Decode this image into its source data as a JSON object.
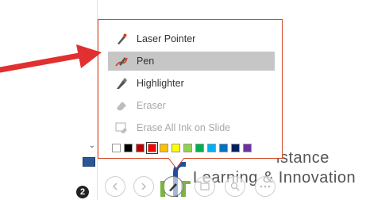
{
  "menu": {
    "items": [
      {
        "label": "Laser Pointer",
        "icon": "laser-pointer-icon",
        "enabled": true,
        "selected": false
      },
      {
        "label": "Pen",
        "icon": "pen-icon",
        "enabled": true,
        "selected": true
      },
      {
        "label": "Highlighter",
        "icon": "highlighter-icon",
        "enabled": true,
        "selected": false
      },
      {
        "label": "Eraser",
        "icon": "eraser-icon",
        "enabled": false,
        "selected": false
      },
      {
        "label": "Erase All Ink on Slide",
        "icon": "erase-all-icon",
        "enabled": false,
        "selected": false
      }
    ],
    "colors": [
      "#ffffff",
      "#000000",
      "#c00000",
      "#ff0000",
      "#ffc000",
      "#ffff00",
      "#92d050",
      "#00b050",
      "#00b0f0",
      "#0070c0",
      "#002060",
      "#7030a0"
    ],
    "selected_color": "#ff0000",
    "accent_border": "#d24726"
  },
  "slide": {
    "text_line_1": "istance",
    "text_line_2": "Learning & Innovation"
  },
  "sidebar": {
    "slide_number": "2"
  },
  "annotation": {
    "arrow_color": "#e03030"
  }
}
